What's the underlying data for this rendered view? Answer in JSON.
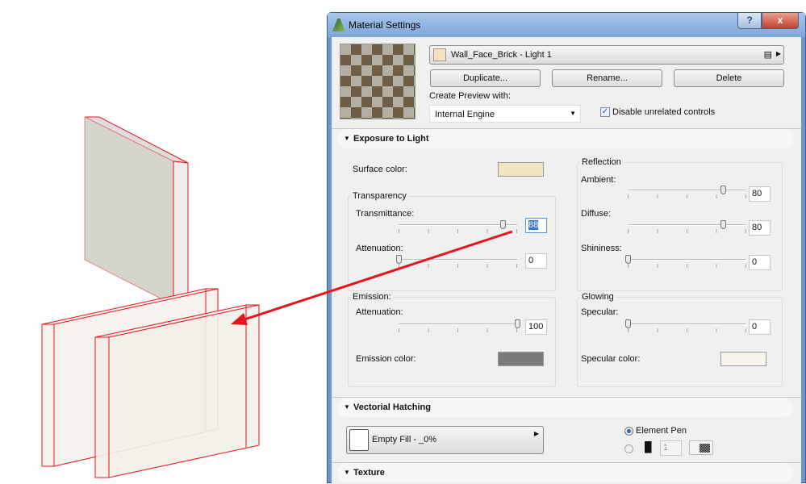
{
  "window": {
    "title": "Material Settings",
    "help_label": "?",
    "close_label": "x"
  },
  "material": {
    "name": "Wall_Face_Brick - Light 1",
    "swatch_color": "#f2e4bf"
  },
  "buttons": {
    "duplicate": "Duplicate...",
    "rename": "Rename...",
    "delete": "Delete"
  },
  "preview": {
    "label": "Create Preview with:",
    "engine": "Internal Engine",
    "disable_label": "Disable unrelated controls",
    "disable_checked": true
  },
  "exposure": {
    "title": "Exposure to Light",
    "surface_color_label": "Surface color:",
    "surface_color": "#f2e4bf",
    "transparency": {
      "title": "Transparency",
      "transmittance_label": "Transmittance:",
      "transmittance": "88",
      "attenuation_label": "Attenuation:",
      "attenuation": "0"
    },
    "reflection": {
      "title": "Reflection",
      "ambient_label": "Ambient:",
      "ambient": "80",
      "diffuse_label": "Diffuse:",
      "diffuse": "80",
      "shininess_label": "Shininess:",
      "shininess": "0"
    },
    "emission": {
      "title": "Emission:",
      "attenuation_label": "Attenuation:",
      "attenuation": "100",
      "color_label": "Emission color:",
      "color": "#7a7a7a"
    },
    "glowing": {
      "title": "Glowing",
      "specular_label": "Specular:",
      "specular": "0",
      "color_label": "Specular color:",
      "color": "#f8f4ee"
    }
  },
  "hatching": {
    "title": "Vectorial Hatching",
    "fill": "Empty Fill - _0%",
    "element_pen_label": "Element Pen",
    "pen_number": "1"
  },
  "texture": {
    "title": "Texture"
  },
  "colors": {
    "annotation": "#e8141c"
  }
}
